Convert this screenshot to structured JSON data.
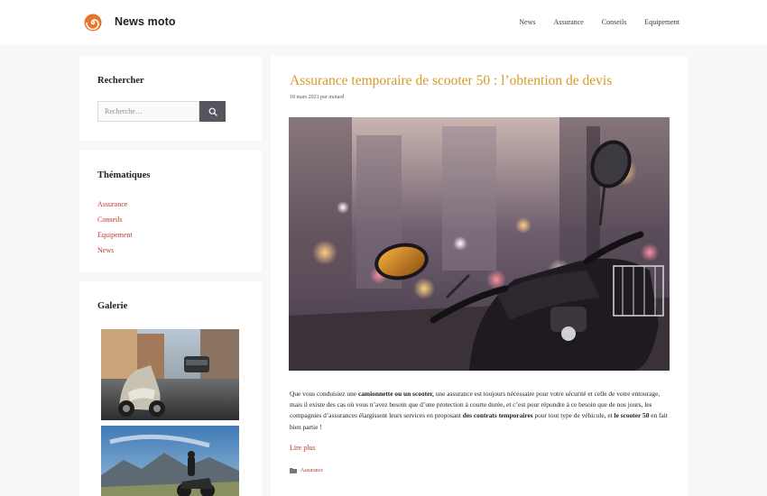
{
  "header": {
    "site_title": "News moto",
    "nav": [
      "News",
      "Assurance",
      "Conseils",
      "Equipement"
    ]
  },
  "sidebar": {
    "search": {
      "title": "Rechercher",
      "placeholder": "Recherche…",
      "button_icon": "search-icon"
    },
    "topics": {
      "title": "Thématiques",
      "items": [
        "Assurance",
        "Conseils",
        "Equipement",
        "News"
      ]
    },
    "gallery": {
      "title": "Galerie"
    }
  },
  "article": {
    "title": "Assurance temporaire de scooter 50 : l’obtention de devis",
    "meta": "18 mars 2021 par motard",
    "excerpt": {
      "p1": "Que vous conduisiez une ",
      "b1": "camionnette ou un scooter,",
      "p2": " une assurance est toujours nécessaire pour votre sécurité et celle de votre entourage, mais il existe des cas où vous n’avez besoin que d’une protection à courte durée, et c’est pour répondre à ce besoin que de nos jours, les compagnies d’assurances élargissent leurs services en proposant ",
      "b2": "des contrats temporaires",
      "p3": " pour tout type de véhicule, et ",
      "b3": "le scooter 50",
      "p4": " en fait bien partie !"
    },
    "read_more": "Lire plus",
    "category": "Assurance",
    "category_icon": "folder-icon"
  },
  "colors": {
    "accent_link": "#c0392b",
    "title_orange": "#d89a2b",
    "search_button": "#55555e",
    "background": "#f7f8f9"
  }
}
